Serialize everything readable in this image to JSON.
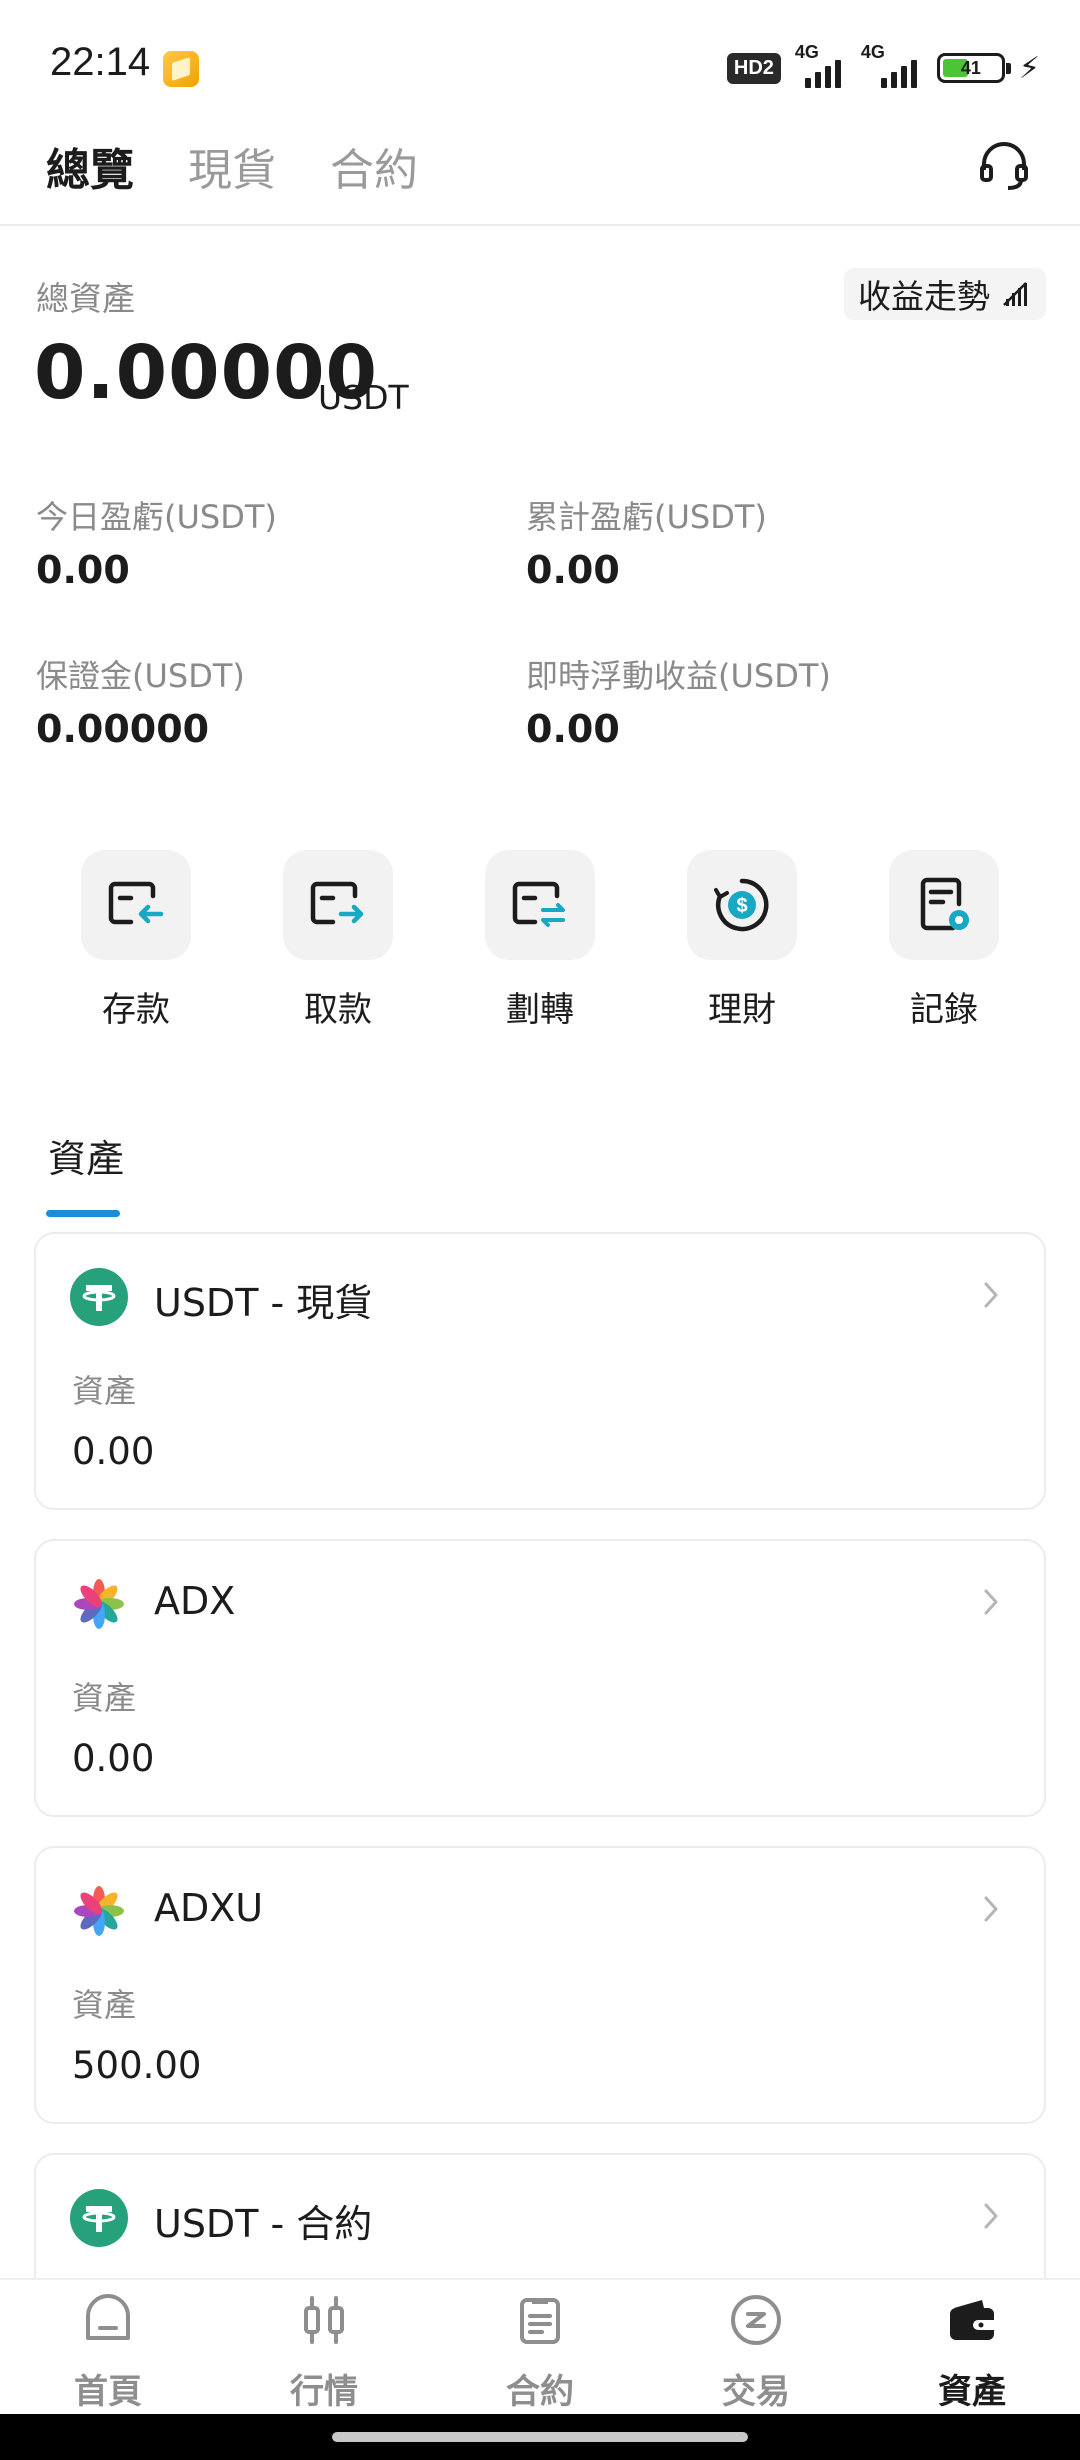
{
  "status_bar": {
    "time": "22:14",
    "hd_label": "HD2",
    "network_1": "4G",
    "network_2": "4G",
    "battery_level": "41",
    "charging_icon": "bolt-icon"
  },
  "header": {
    "tabs": [
      {
        "label": "總覽",
        "active": true
      },
      {
        "label": "現貨",
        "active": false
      },
      {
        "label": "合約",
        "active": false
      }
    ],
    "support_icon": "headset-icon"
  },
  "overview": {
    "total_label": "總資產",
    "trend_button": "收益走勢",
    "total_value": "0.00000",
    "total_unit": "USDT",
    "stats": [
      {
        "label": "今日盈虧(USDT)",
        "value": "0.00"
      },
      {
        "label": "累計盈虧(USDT)",
        "value": "0.00"
      },
      {
        "label": "保證金(USDT)",
        "value": "0.00000"
      },
      {
        "label": "即時浮動收益(USDT)",
        "value": "0.00"
      }
    ]
  },
  "actions": [
    {
      "label": "存款",
      "icon": "deposit-icon"
    },
    {
      "label": "取款",
      "icon": "withdraw-icon"
    },
    {
      "label": "劃轉",
      "icon": "transfer-icon"
    },
    {
      "label": "理財",
      "icon": "finance-icon"
    },
    {
      "label": "記錄",
      "icon": "records-icon"
    }
  ],
  "assets_section": {
    "tab_label": "資產",
    "cards": [
      {
        "name": "USDT - 現貨",
        "sub_label": "資產",
        "value": "0.00",
        "icon": "tether-icon"
      },
      {
        "name": "ADX",
        "sub_label": "資產",
        "value": "0.00",
        "icon": "adx-logo-icon"
      },
      {
        "name": "ADXU",
        "sub_label": "資產",
        "value": "500.00",
        "icon": "adx-logo-icon"
      },
      {
        "name": "USDT - 合約",
        "sub_label": "",
        "value": "",
        "icon": "tether-icon"
      }
    ]
  },
  "bottom_nav": [
    {
      "label": "首頁",
      "icon": "home-icon",
      "active": false
    },
    {
      "label": "行情",
      "icon": "market-icon",
      "active": false
    },
    {
      "label": "合約",
      "icon": "contract-icon",
      "active": false
    },
    {
      "label": "交易",
      "icon": "trade-icon",
      "active": false
    },
    {
      "label": "資產",
      "icon": "wallet-icon",
      "active": true
    }
  ],
  "colors": {
    "accent": "#1a8fd8",
    "tether_green": "#26a17b",
    "action_teal": "#17a9c4"
  }
}
